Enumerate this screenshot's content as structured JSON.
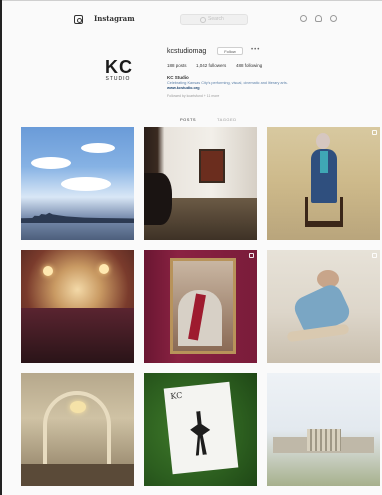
{
  "app": {
    "wordmark": "Instagram",
    "search_placeholder": "Search"
  },
  "profile": {
    "logo_big": "KC",
    "logo_small": "STUDIO",
    "username": "kcstudiomag",
    "follow_label": "Follow",
    "more_label": "•••",
    "stats": {
      "posts": "188 posts",
      "followers": "1,042 followers",
      "following": "488 following"
    },
    "bio_name": "KC Studio",
    "bio_text": "Celebrating Kansas City's performing, visual, cinematic and literary arts.",
    "bio_link": "www.kcstudio.org",
    "followed_by": "Followed by kcartsfund + 11 more"
  },
  "tabs": {
    "posts": "POSTS",
    "tagged": "TAGGED"
  },
  "colors": {
    "link": "#234a74",
    "bio": "#5a7fa8"
  }
}
